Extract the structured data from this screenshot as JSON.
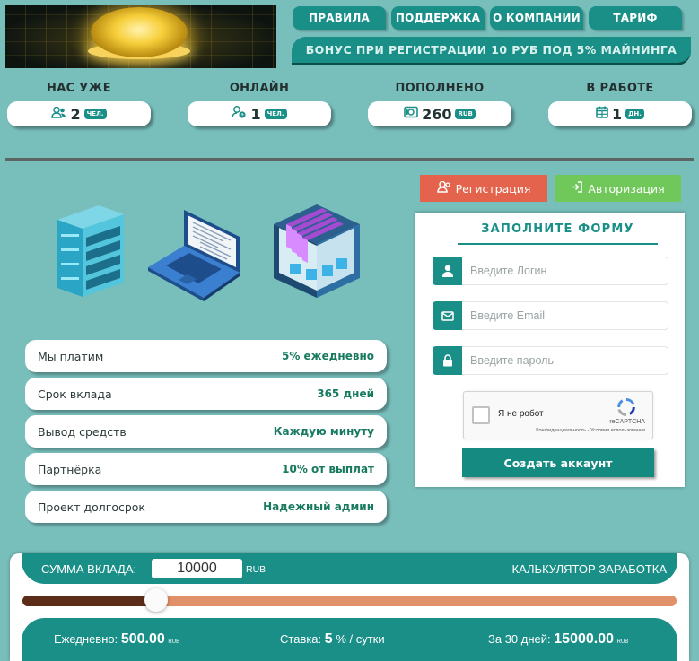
{
  "nav": {
    "rules": "ПРАВИЛА",
    "support": "ПОДДЕРЖКА",
    "about": "О КОМПАНИИ",
    "tariff": "ТАРИФ"
  },
  "bonus_text": "БОНУС ПРИ РЕГИСТРАЦИИ 10 РУБ ПОД 5% МАЙНИНГА",
  "stats": [
    {
      "label": "НАС УЖЕ",
      "value": "2",
      "unit": "ЧЕЛ.",
      "icon": "users-icon"
    },
    {
      "label": "ОНЛАЙН",
      "value": "1",
      "unit": "ЧЕЛ.",
      "icon": "user-clock-icon"
    },
    {
      "label": "ПОПОЛНЕНО",
      "value": "260",
      "unit": "RUB",
      "icon": "money-icon"
    },
    {
      "label": "В РАБОТЕ",
      "value": "1",
      "unit": "ДН.",
      "icon": "calendar-icon"
    }
  ],
  "info_rows": [
    {
      "key": "Мы платим",
      "value": "5% ежедневно"
    },
    {
      "key": "Срок вклада",
      "value": "365 дней"
    },
    {
      "key": "Вывод средств",
      "value": "Каждую минуту"
    },
    {
      "key": "Партнёрка",
      "value": "10% от выплат"
    },
    {
      "key": "Проект долгосрок",
      "value": "Надежный админ"
    }
  ],
  "auth": {
    "register_label": "Регистрация",
    "login_label": "Авторизация"
  },
  "form": {
    "title": "ЗАПОЛНИТЕ ФОРМУ",
    "login_placeholder": "Введите Логин",
    "email_placeholder": "Введите Email",
    "password_placeholder": "Введите пароль",
    "captcha_label": "Я не робот",
    "captcha_brand": "reCAPTCHA",
    "captcha_links": "Конфиденциальность - Условия использования",
    "submit_label": "Создать аккаунт"
  },
  "calculator": {
    "amount_label": "СУММА ВКЛАДА:",
    "amount_value": "10000",
    "currency": "RUB",
    "title": "КАЛЬКУЛЯТОР ЗАРАБОТКА",
    "slider_fraction": 0.205,
    "daily_label": "Ежедневно:",
    "daily_value": "500.00",
    "rate_label": "Ставка:",
    "rate_value": "5",
    "rate_unit": "% / сутки",
    "month_label": "За 30 дней:",
    "month_value": "15000.00",
    "small_currency": "RUB"
  },
  "colors": {
    "background": "#78bfbc",
    "accent": "#1a8f88",
    "register": "#e4634c",
    "login": "#71c85a",
    "slider_track": "#e09169",
    "slider_fill": "#5b2d18"
  }
}
